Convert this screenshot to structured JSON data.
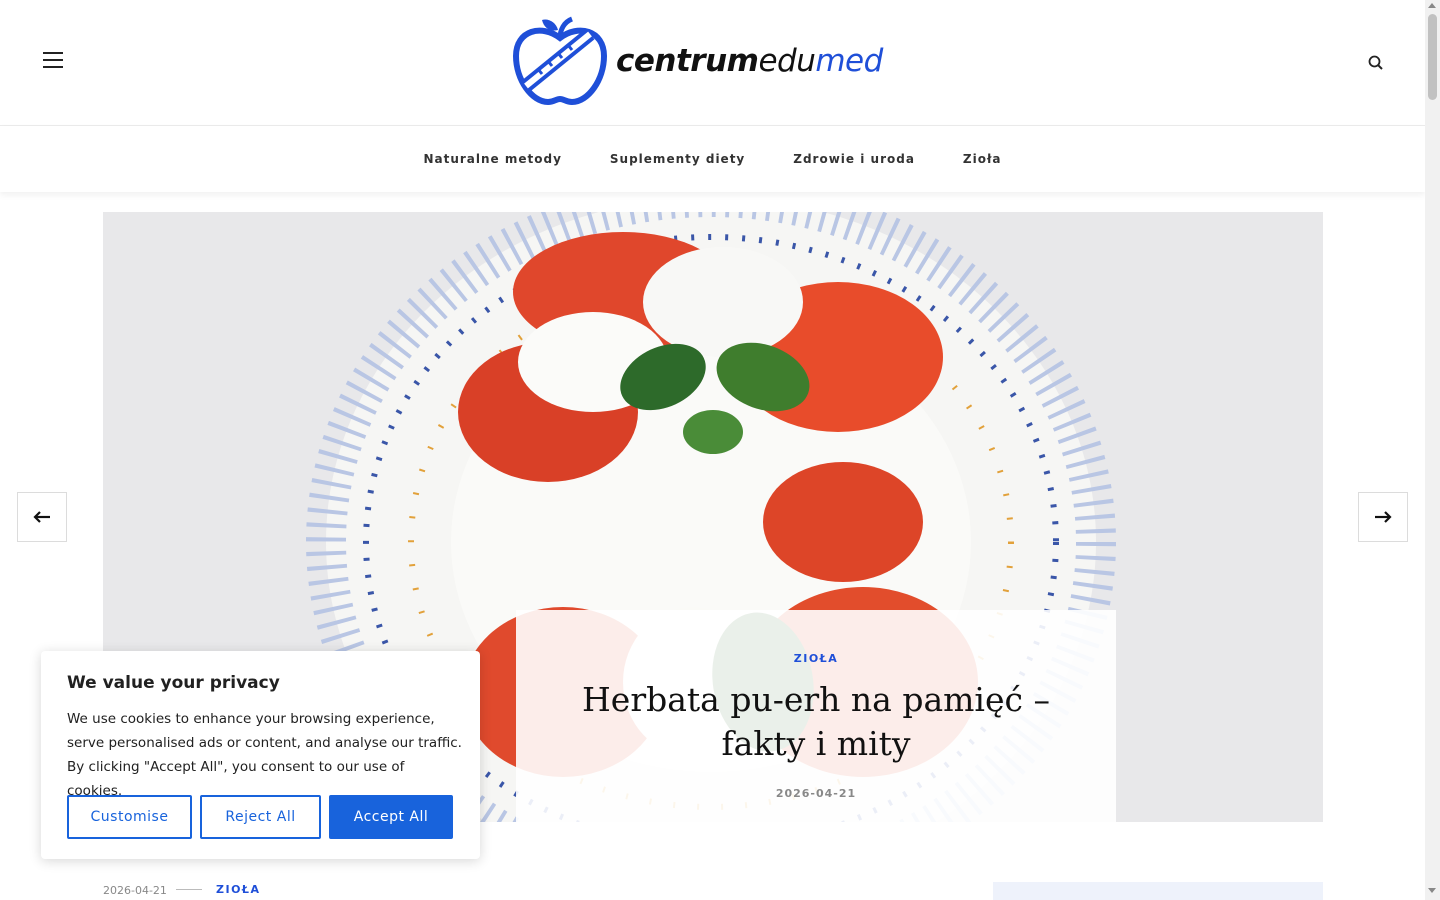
{
  "header": {
    "logo_text_1": "centrum",
    "logo_text_2": "edu",
    "logo_text_3": "med"
  },
  "nav": {
    "items": [
      {
        "label": "Naturalne metody"
      },
      {
        "label": "Suplementy diety"
      },
      {
        "label": "Zdrowie i uroda"
      },
      {
        "label": "Zioła"
      }
    ]
  },
  "hero": {
    "category": "ZIOŁA",
    "title": "Herbata pu-erh na pamięć – fakty i mity",
    "date": "2026-04-21"
  },
  "post_meta": {
    "date": "2026-04-21",
    "category": "ZIOŁA"
  },
  "cookie": {
    "title": "We value your privacy",
    "text": "We use cookies to enhance your browsing experience, serve personalised ads or content, and analyse our traffic. By clicking \"Accept All\", you consent to our use of cookies.",
    "customise_label": "Customise",
    "reject_label": "Reject All",
    "accept_label": "Accept All"
  },
  "colors": {
    "accent": "#1f4fd8",
    "cookie_button": "#1863dc"
  },
  "icons": {
    "menu": "hamburger-icon",
    "search": "search-icon",
    "prev": "arrow-left-icon",
    "next": "arrow-right-icon",
    "logo": "apple-logo-icon"
  }
}
